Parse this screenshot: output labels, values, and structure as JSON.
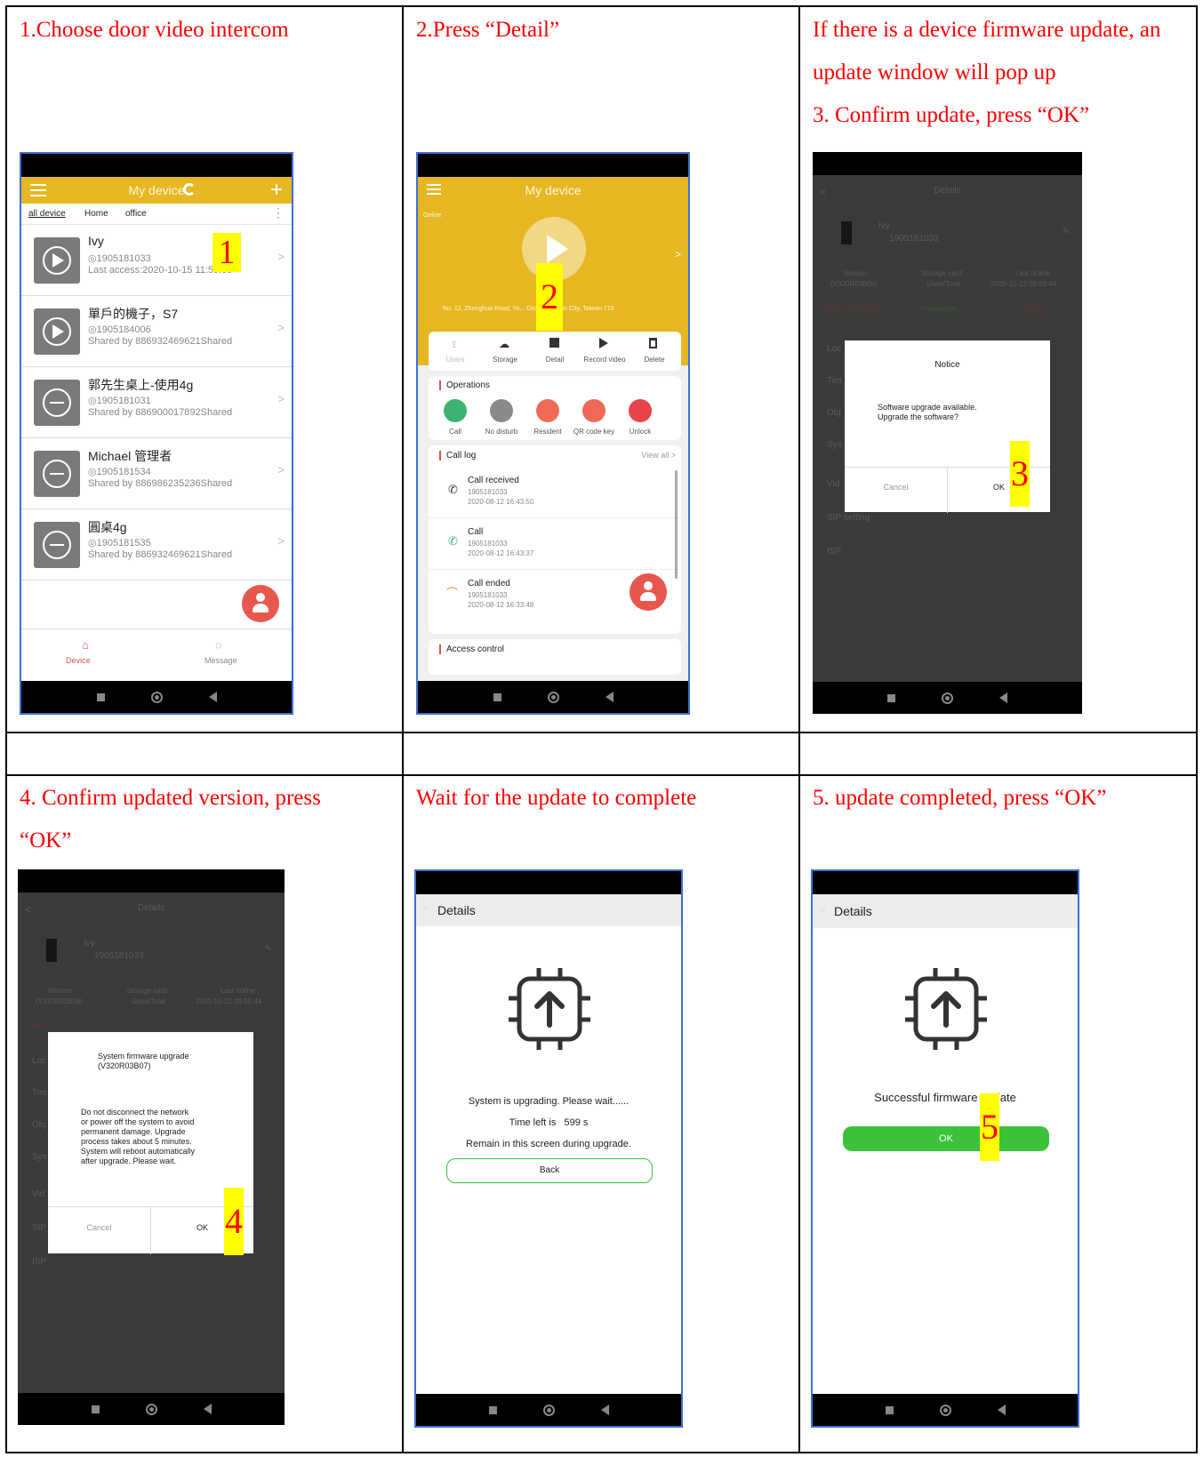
{
  "captions": {
    "c1": "1.Choose door video intercom",
    "c2": "2.Press “Detail”",
    "c3a": "If there is a device firmware update, an",
    "c3b": "update window will pop up",
    "c3c": "3. Confirm update, press “OK”",
    "c4a": "4. Confirm updated version, press",
    "c4b": "“OK”",
    "c5": "Wait for the update to complete",
    "c6": "5. update completed, press “OK”"
  },
  "markers": [
    "1",
    "2",
    "3",
    "4",
    "5"
  ],
  "screen1": {
    "title": "My device",
    "tabs": [
      "all device",
      "Home",
      "office"
    ],
    "devices": [
      {
        "name": "Ivy",
        "id": "◎1905181033",
        "info": "Last access:2020-10-15 11:59:09"
      },
      {
        "name": "單戶的機子，S7",
        "id": "◎1905184006",
        "info": "Shared by 886932469621Shared"
      },
      {
        "name": "郭先生桌上-使用4g",
        "id": "◎1905181031",
        "info": "Shared by 886900017892Shared"
      },
      {
        "name": "Michael 管理者",
        "id": "◎1905181534",
        "info": "Shared by 886986235236Shared"
      },
      {
        "name": "圓桌4g",
        "id": "◎1905181535",
        "info": "Shared by 886932469621Shared"
      }
    ],
    "bottom_tabs": [
      "Device",
      "Message"
    ]
  },
  "screen2": {
    "title": "My device",
    "status": "Online",
    "address": "No. 12, Zhonghua Road, Yo... District, Tainan City, Taiwan 710",
    "toolbar": [
      "Users",
      "Storage",
      "Detail",
      "Record video",
      "Delete"
    ],
    "operations_title": "Operations",
    "operations": [
      "Call",
      "No disturb",
      "Resident",
      "QR code key",
      "Unlock"
    ],
    "calllog_title": "Call log",
    "view_all": "View all >",
    "calls": [
      {
        "type": "Call received",
        "id": "1905181033",
        "time": "2020-08-12 16:43:50"
      },
      {
        "type": "Call",
        "id": "1905181033",
        "time": "2020-08-12 16:43:37"
      },
      {
        "type": "Call ended",
        "id": "1905181033",
        "time": "2020-08-12 16:33:48"
      }
    ],
    "access_title": "Access control"
  },
  "screen3": {
    "header": "Details",
    "device_name": "Ivy",
    "device_id": "1905181033",
    "cols": [
      "Version",
      "Storage card",
      "Last online"
    ],
    "vals": [
      "(V320R03B06)",
      "Used/Total",
      "2020-10-22 09:55:44"
    ],
    "links": [
      "Click to UPGRADE",
      "Format/Info",
      "Reboot"
    ],
    "rows": [
      "Loc",
      "Tim",
      "Obj",
      "Sys",
      "Vid",
      "SIP setting",
      "ISP"
    ],
    "dialog_title": "Notice",
    "dialog_body_1": "Software upgrade available.",
    "dialog_body_2": "Upgrade the software?",
    "cancel": "Cancel",
    "ok": "OK"
  },
  "screen4": {
    "header": "Details",
    "device_name": "Ivy",
    "device_id": "1905181033",
    "cols": [
      "Version",
      "Storage card",
      "Last online"
    ],
    "vals": [
      "(V320R03B06)",
      "Used/Total",
      "2020-10-22 09:55:44"
    ],
    "click": "Click",
    "rows": [
      "Loc",
      "Tim",
      "Obj",
      "Sys",
      "Vid",
      "SIP",
      "ISP"
    ],
    "dialog_title_1": "System firmware upgrade",
    "dialog_title_2": "(V320R03B07)",
    "dialog_body": [
      "Do not disconnect the network",
      "or power off the system to avoid",
      "permanent damage. Upgrade",
      "process takes about 5 minutes.",
      "System will reboot automatically",
      "after upgrade. Please wait."
    ],
    "cancel": "Cancel",
    "ok": "OK"
  },
  "screen5": {
    "header": "Details",
    "line1": "System is upgrading. Please wait......",
    "line2": "Time left is   599 s",
    "line3": "Remain in this screen during upgrade.",
    "back": "Back"
  },
  "screen6": {
    "header": "Details",
    "message": "Successful firmware update",
    "ok": "OK"
  },
  "colors": {
    "caption": "#ff0000",
    "marker_bg": "#ffff00",
    "app_yellow": "#e6b723",
    "success_green": "#3cc13b",
    "fab_red": "#e8574e"
  }
}
